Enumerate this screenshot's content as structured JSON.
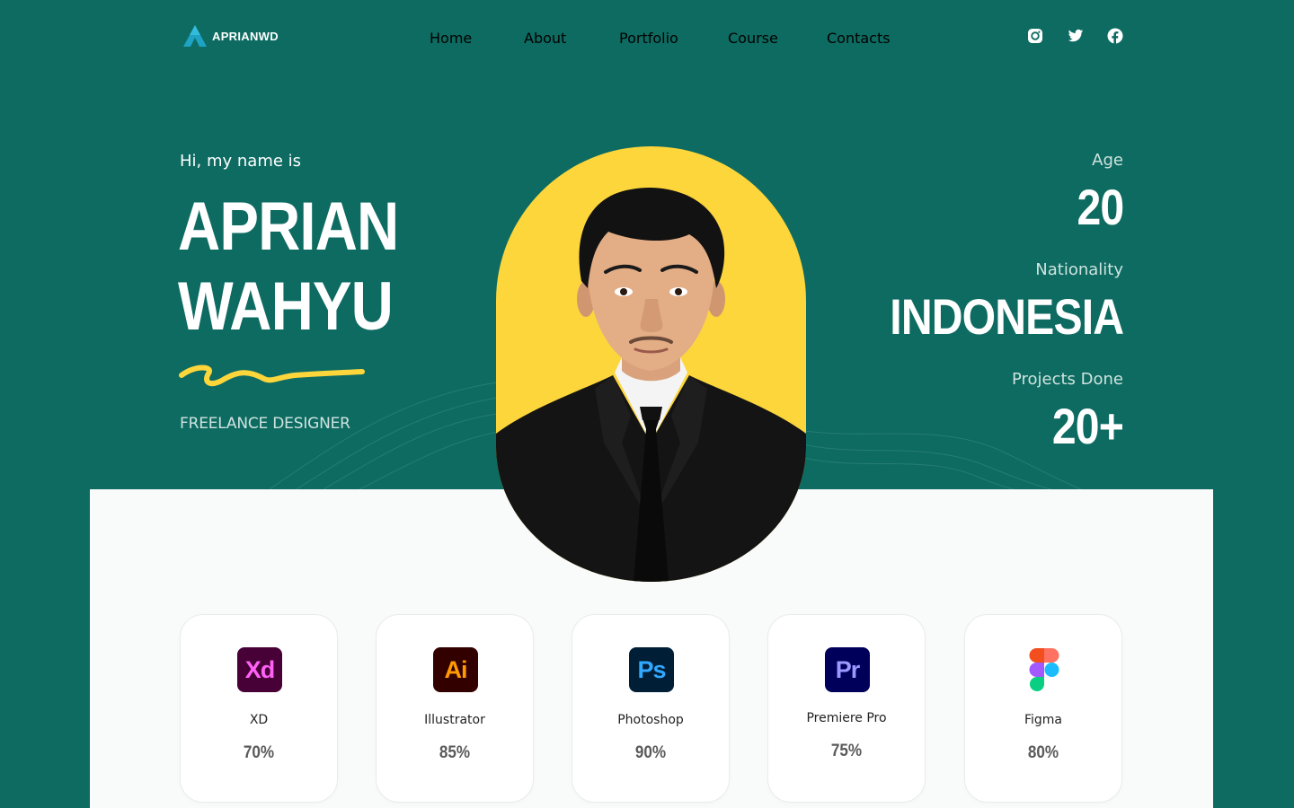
{
  "brand": {
    "name": "APRIANWD"
  },
  "nav": {
    "items": [
      {
        "label": "Home"
      },
      {
        "label": "About"
      },
      {
        "label": "Portfolio"
      },
      {
        "label": "Course"
      },
      {
        "label": "Contacts"
      }
    ]
  },
  "social": [
    "instagram-icon",
    "twitter-icon",
    "facebook-icon"
  ],
  "hero": {
    "greeting": "Hi, my name is",
    "first_name": "APRIAN",
    "last_name": "WAHYU",
    "role": "FREELANCE DESIGNER"
  },
  "stats": {
    "age_label": "Age",
    "age_value": "20",
    "nationality_label": "Nationality",
    "nationality_value": "INDONESIA",
    "projects_label": "Projects Done",
    "projects_value": "20+"
  },
  "skills": [
    {
      "icon_text": "Xd",
      "name": "XD",
      "percent": "70%",
      "icon_bg": "#470137",
      "icon_fg": "#ff61f6"
    },
    {
      "icon_text": "Ai",
      "name": "Illustrator",
      "percent": "85%",
      "icon_bg": "#330000",
      "icon_fg": "#ff9a00"
    },
    {
      "icon_text": "Ps",
      "name": "Photoshop",
      "percent": "90%",
      "icon_bg": "#001e36",
      "icon_fg": "#31a8ff"
    },
    {
      "icon_text": "Pr",
      "name": "Premiere Pro",
      "percent": "75%",
      "icon_bg": "#00005b",
      "icon_fg": "#9999ff"
    },
    {
      "icon_text": "",
      "name": "Figma",
      "percent": "80%",
      "icon_bg": "transparent",
      "icon_fg": "#000000"
    }
  ],
  "colors": {
    "background": "#0d6b61",
    "accent": "#fdd63c",
    "panel": "#f9fbfa"
  }
}
